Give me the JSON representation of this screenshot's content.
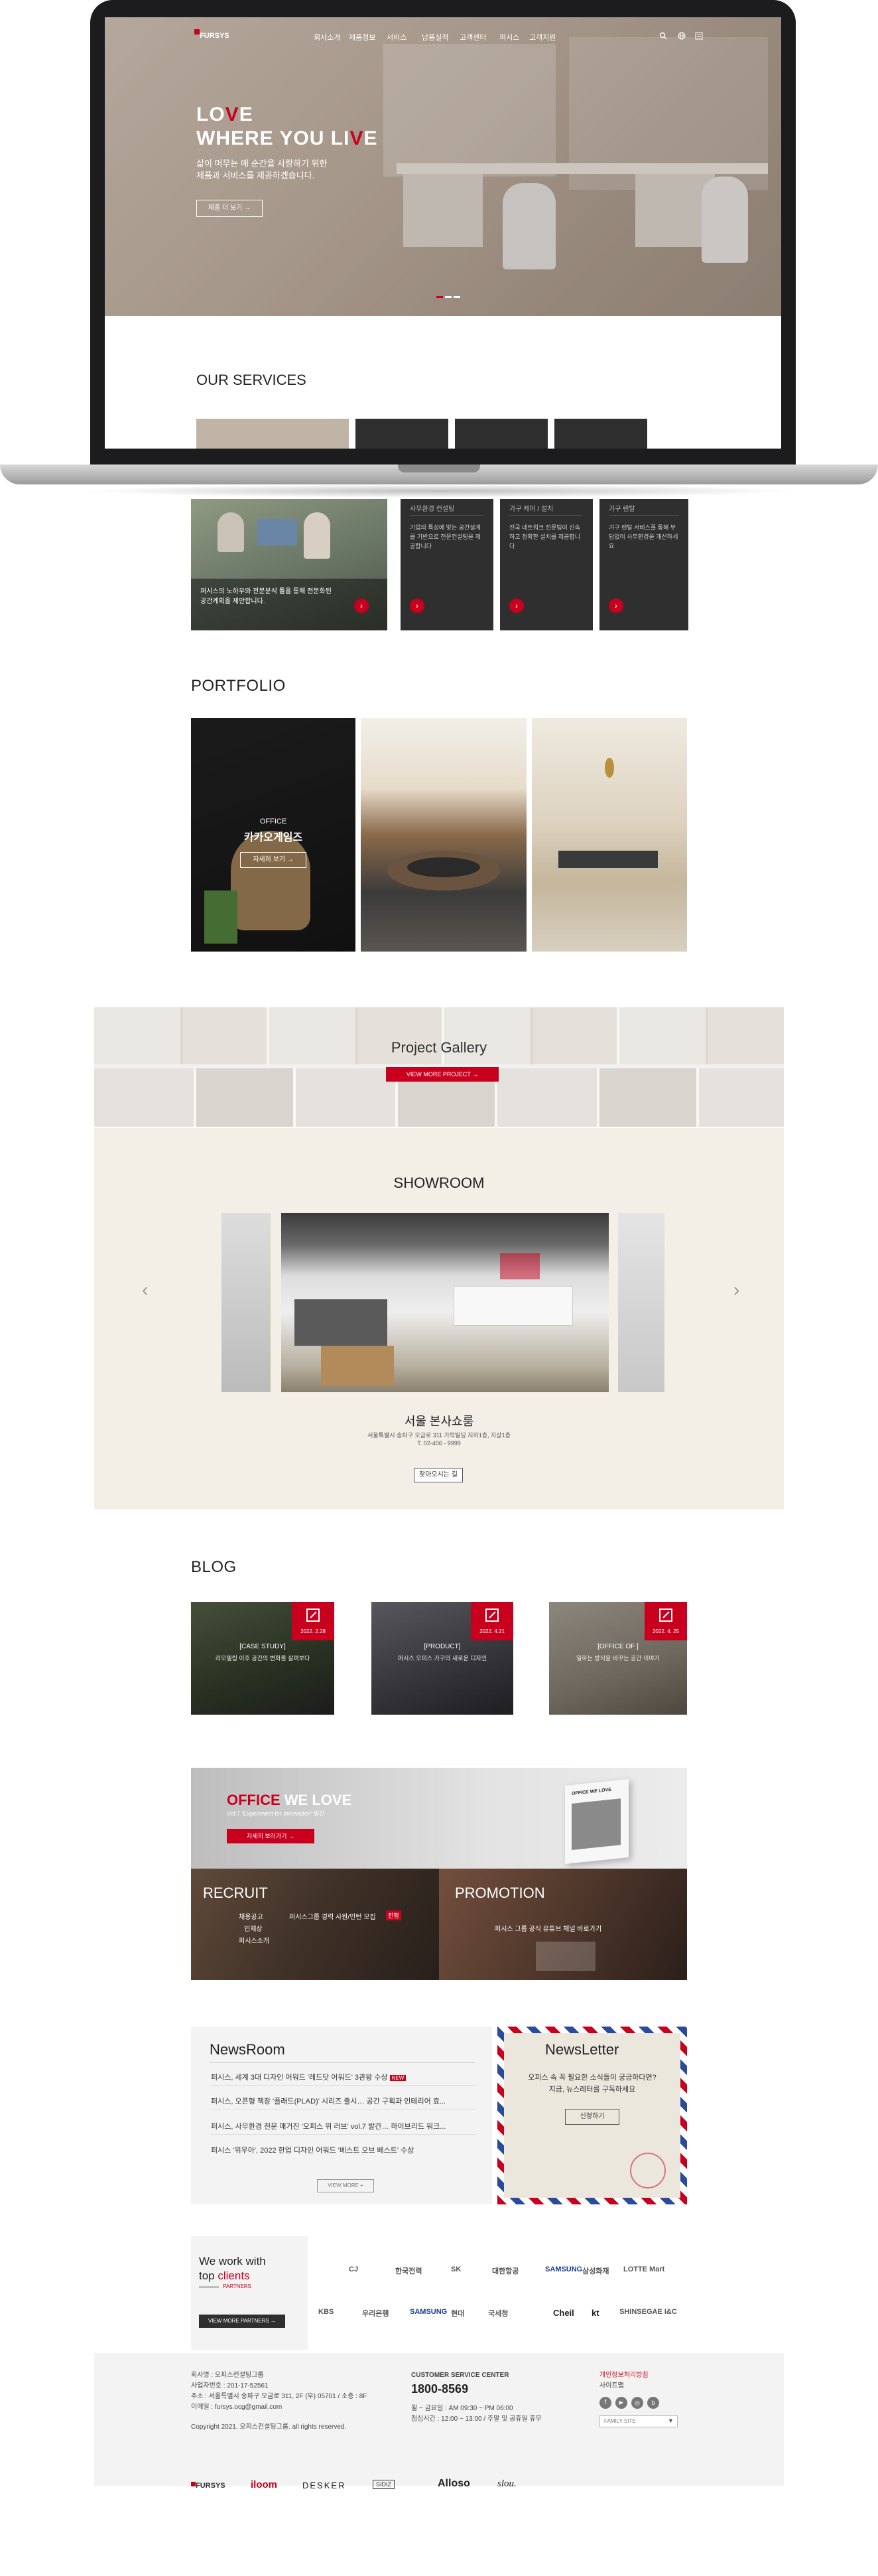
{
  "header": {
    "logo": "FURSYS",
    "nav": [
      "회사소개",
      "제품정보",
      "서비스",
      "납품실적",
      "고객센터",
      "퍼시스",
      "고객지원"
    ]
  },
  "hero": {
    "line1": "LOVE",
    "line2": "WHERE YOU LIVE",
    "sub1": "삶이 머무는 매 순간을 사랑하기 위한",
    "sub2": "제품과 서비스를 제공하겠습니다.",
    "button": "제품 더 보기  →"
  },
  "services": {
    "title": "OUR SERVICES",
    "main_caption": "퍼시스의 노하우와 전문분석 툴을 통해 전문화된 공간계획을 제안합니다.",
    "items": [
      {
        "title": "사무환경 컨설팅",
        "desc": "기업의 특성에 맞는 공간설계를 기반으로 전문컨설팅을 제공합니다"
      },
      {
        "title": "가구 케어 / 설치",
        "desc": "전국 네트워크 전문팀이 신속하고 정확한 설치를 제공합니다"
      },
      {
        "title": "가구 렌탈",
        "desc": "가구 렌탈 서비스를 통해 부담없이 사무환경을 개선하세요"
      }
    ]
  },
  "portfolio": {
    "title": "PORTFOLIO",
    "featured_label": "OFFICE",
    "featured_name": "카카오게임즈",
    "featured_button": "자세히 보기  →"
  },
  "gallery": {
    "title": "Project Gallery",
    "button": "VIEW MORE PROJECT  →"
  },
  "showroom": {
    "title": "SHOWROOM",
    "name": "서울 본사쇼룸",
    "address": "서울특별시 송파구 오금로 311 가락빌딩 지하1층, 지상1층",
    "tel": "T. 02-406 - 9999",
    "button": "찾아오시는 길",
    "prev": "‹",
    "next": "›"
  },
  "blog": {
    "title": "BLOG",
    "posts": [
      {
        "date": "2022. 2.28",
        "tag": "[CASE STUDY]",
        "text": "리모델링 이후 공간의 변화를 살펴보다"
      },
      {
        "date": "2022. 4.21",
        "tag": "[PRODUCT]",
        "text": "퍼시스 오피스 가구의 새로운 디자인"
      },
      {
        "date": "2022. 4. 25",
        "tag": "[OFFICE OF ]",
        "text": "일하는 방식을 바꾸는 공간 이야기"
      }
    ]
  },
  "banner": {
    "title_a": "OFFICE",
    "title_b": " WE LOVE",
    "sub": "Vol.7 'Experiment for Innovation' 발간",
    "button": "자세히 보러가기  →",
    "book_title": "OFFICE WE LOVE"
  },
  "recruit": {
    "title": "RECRUIT",
    "line1": "채용공고",
    "line2": "퍼시스그룹 경력 사원/인턴 모집",
    "badge": "진행",
    "line3": "인재상",
    "line4": "퍼시스소개"
  },
  "promotion": {
    "title": "PROMOTION",
    "line1": "퍼시스 그룹 공식 유튜브 채널 바로가기"
  },
  "newsroom": {
    "title": "NewsRoom",
    "items": [
      "퍼시스, 세계 3대 디자인 어워드 '레드닷 어워드' 3관왕 수상",
      "퍼시스, 오픈형 책장 '플래드(PLAD)' 시리즈 출시… 공간 구획과 인테리어 효...",
      "퍼시스, 사무환경 전문 매거진 '오피스 위 러브' vol.7 발간… 하이브리드 워크...",
      "퍼시스 '위우아', 2022 한업 디자인 어워드 '베스트 오브 베스트' 수상"
    ],
    "new_badge": "NEW",
    "button": "VIEW MORE  +"
  },
  "newsletter": {
    "title": "NewsLetter",
    "text1": "오피스 속 꼭 필요한 소식들이 궁금하다면?",
    "text2": "지금, 뉴스레터를 구독하세요",
    "button": "신청하기"
  },
  "clients": {
    "title1": "We work with",
    "title2_a": "top ",
    "title2_b": "clients",
    "partners": "PARTNERS",
    "button": "VIEW MORE PARTNERS  →",
    "logos_row1": [
      "CJ",
      "한국전력",
      "SK",
      "대한항공",
      "SAMSUNG",
      "삼성화재",
      "LOTTE Mart"
    ],
    "logos_row2": [
      "KBS",
      "우리은행",
      "SAMSUNG",
      "현대",
      "국세청",
      "Cheil",
      "kt",
      "SHINSEGAE I&C"
    ]
  },
  "footer": {
    "company": "회사명 : 오피스컨설팅그룹",
    "bizno": "사업자번호 : 201-17-52561",
    "address": "주소 : 서울특별시 송파구 오금로 311, 2F (우) 05701 / 소층 : 8F",
    "email": "이메일 : fursys.ocg@gmail.com",
    "copyright": "Copyright 2021. 오피스컨설팅그룹. all rights reserved.",
    "cs_title": "CUSTOMER SERVICE CENTER",
    "cs_phone": "1800-8569",
    "cs_hours1": "월 ~ 금요일 : AM 09:30 ~ PM 06:00",
    "cs_hours2": "점심시간 : 12:00 ~ 13:00 / 주말 및 공휴일 휴무",
    "privacy": "개인정보처리방침",
    "sitemap": "사이트맵",
    "family": "FAMILY SITE",
    "brands": [
      "FURSYS",
      "iloom",
      "DESKER",
      "SIDIZ",
      "Alloso",
      "slou."
    ]
  },
  "colors": {
    "accent": "#c8001e",
    "dark": "#2f2f2f",
    "beige": "#f3efe6"
  }
}
